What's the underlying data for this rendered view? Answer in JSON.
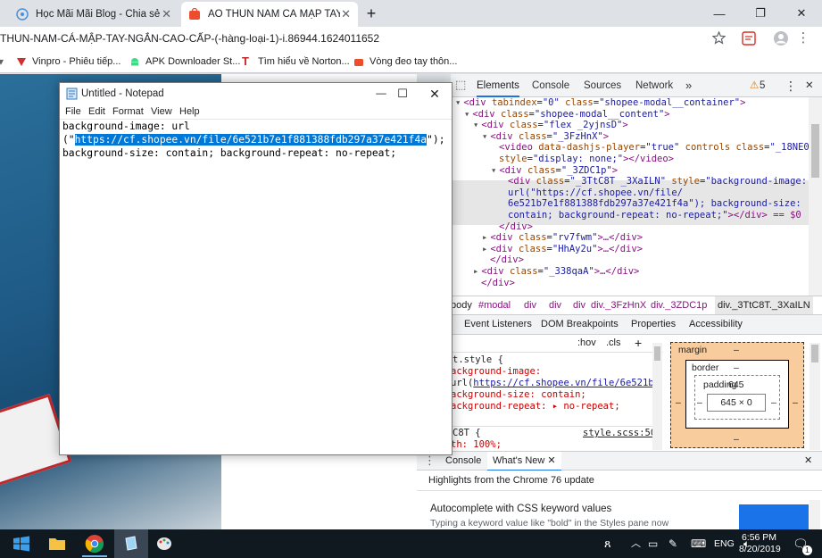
{
  "browser": {
    "tabs": [
      {
        "title": "Học Mãi Mãi Blog - Chia sẻ kiến",
        "active": false
      },
      {
        "title": "ÁO THUN NAM CÁ MẬP TAY NG",
        "active": true
      }
    ],
    "new_tab": "+",
    "window_controls": {
      "minimize": "—",
      "restore": "❐",
      "close": "✕"
    },
    "url_host_path": "THUN-NAM-CÁ-MẬP-TAY-NGẮN-CAO-CẤP-(-hàng-loại-1)-i.86944.1624011652",
    "bookmarks": [
      "Vinpro - Phiêu tiếp...",
      "APK Downloader St...",
      "Tìm hiểu về Norton...",
      "Vòng đeo tay thôn..."
    ],
    "brand_color": "#ee4d2d"
  },
  "notepad": {
    "title": "Untitled - Notepad",
    "menu": [
      "File",
      "Edit",
      "Format",
      "View",
      "Help"
    ],
    "line1": "background-image: url",
    "line2_pre": "(\"",
    "line2_selected": "https://cf.shopee.vn/file/6e521b7e1f881388fdb297a37e421f4a",
    "line2_post": "\");",
    "line3": "background-size: contain; background-repeat: no-repeat;"
  },
  "devtools": {
    "tabs": [
      "Elements",
      "Console",
      "Sources",
      "Network"
    ],
    "more": "»",
    "warnings": "5",
    "warn_icon": "⚠",
    "menu_dots": "⋮",
    "close": "✕",
    "dom_lines": [
      {
        "indent": 0,
        "tri": "▾",
        "tag_open": "<div ",
        "attr": "tabindex",
        "val": "\"0\"",
        "attr2": " class",
        "val2": "\"shopee-modal__container\"",
        "end": ">"
      },
      {
        "indent": 1,
        "tri": "▾",
        "tag_open": "<div ",
        "attr": "class",
        "val": "\"shopee-modal__content\"",
        "end": ">"
      },
      {
        "indent": 2,
        "tri": "▾",
        "tag_open": "<div ",
        "attr": "class",
        "val": "\"flex _2yjnsD\"",
        "end": ">"
      },
      {
        "indent": 3,
        "tri": "▾",
        "tag_open": "<div ",
        "attr": "class",
        "val": "\"_3FzHnX\"",
        "end": ">"
      },
      {
        "indent": 4,
        "tri": "",
        "tag_open": "<video ",
        "attr": "data-dashjs-player",
        "val": "\"true\"",
        "attr2": " controls class",
        "val2": "\"_18NE0y\"",
        "end": ""
      },
      {
        "indent": 4,
        "tri": "",
        "tag_open": "",
        "attr": "style",
        "val": "\"display: none;\"",
        "end": "></video>"
      },
      {
        "indent": 4,
        "tri": "▾",
        "tag_open": "<div ",
        "attr": "class",
        "val": "\"_3ZDC1p\"",
        "end": ">"
      },
      {
        "indent": 5,
        "tri": "",
        "tag_open": "<div ",
        "attr": "class",
        "val": "\"_3TtC8T _3XaILN\"",
        "attr2": " style",
        "val2": "\"background-image:",
        "end": ""
      },
      {
        "indent": 5,
        "tri": "",
        "tag_open": "",
        "attr": "",
        "val": "url(\"https://cf.shopee.vn/file/",
        "end": ""
      },
      {
        "indent": 5,
        "tri": "",
        "tag_open": "",
        "attr": "",
        "val": "6e521b7e1f881388fdb297a37e421f4a\"); background-size:",
        "end": ""
      },
      {
        "indent": 5,
        "tri": "",
        "tag_open": "",
        "attr": "",
        "val": "contain; background-repeat: no-repeat;\"",
        "end": "></div> == $0"
      },
      {
        "indent": 4,
        "tri": "",
        "tag_open": "",
        "attr": "",
        "val": "",
        "end": "</div>"
      },
      {
        "indent": 3,
        "tri": "▸",
        "tag_open": "<div ",
        "attr": "class",
        "val": "\"rv7fwm\"",
        "end": ">…</div>"
      },
      {
        "indent": 3,
        "tri": "▸",
        "tag_open": "<div ",
        "attr": "class",
        "val": "\"HhAy2u\"",
        "end": ">…</div>"
      },
      {
        "indent": 3,
        "tri": "",
        "tag_open": "",
        "attr": "",
        "val": "",
        "end": "</div>"
      },
      {
        "indent": 2,
        "tri": "▸",
        "tag_open": "<div ",
        "attr": "class",
        "val": "\"_338qaA\"",
        "end": ">…</div>"
      },
      {
        "indent": 2,
        "tri": "",
        "tag_open": "",
        "attr": "",
        "val": "",
        "end": "</div>"
      }
    ],
    "breadcrumbs": [
      "body",
      "#modal",
      "div",
      "div",
      "div",
      "div._3FzHnX",
      "div._3ZDC1p",
      "div._3TtC8T._3XaILN"
    ],
    "subtabs": [
      "Event Listeners",
      "DOM Breakpoints",
      "Properties",
      "Accessibility"
    ],
    "filter": {
      "hov": ":hov",
      "cls": ".cls",
      "add": "+"
    },
    "styles": {
      "rule1_selector": "t.style {",
      "l1": "ackground-image:",
      "l2_pre": "url(",
      "l2_link": "https://cf.shopee.vn/file/6e521b7…",
      "l2_post": ")",
      "l3": "ackground-size: contain;",
      "l4": "ackground-repeat: ▸ no-repeat;",
      "rule2_selector": "C8T {",
      "rule2_source": "style.scss:50",
      "l5": "th: 100%;"
    },
    "box_model": {
      "margin_label": "margin",
      "margin_value": "–",
      "border_label": "border",
      "border_value": "–",
      "padding_label": "padding",
      "padding_value": "645",
      "content": "645 × 0",
      "side_dash": "–"
    },
    "drawer": {
      "tabs": [
        "Console",
        "What's New"
      ],
      "close": "✕",
      "heading": "Highlights from the Chrome 76 update",
      "item_title": "Autocomplete with CSS keyword values",
      "item_desc": "Typing a keyword value like \"bold\" in the Styles pane now"
    }
  },
  "taskbar": {
    "lang": "ENG",
    "time": "6:56 PM",
    "date": "8/20/2019",
    "notifications": "1"
  }
}
